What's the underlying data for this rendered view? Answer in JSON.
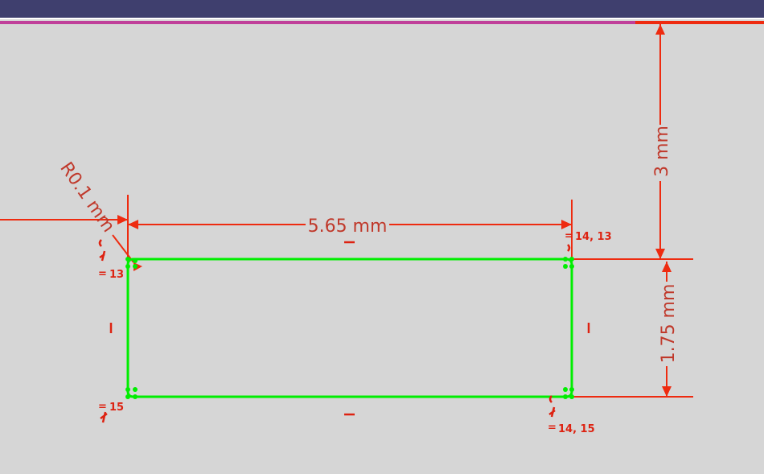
{
  "colors": {
    "background": "#d6d6d6",
    "topbar": "#3f3f6e",
    "accent_line": "#c0409a",
    "dimension": "#ee2b10",
    "dimension_text": "#c0392b",
    "constraint": "#dd2211",
    "geometry": "#00ee00"
  },
  "dimensions": {
    "width": "5.65 mm",
    "height": "1.75 mm",
    "offset": "3 mm",
    "radius": "R0.1 mm"
  },
  "constraints": {
    "top_left": "13",
    "top_right": "14, 13",
    "bottom_left": "15",
    "bottom_right": "14, 15",
    "equal_mark": "="
  }
}
